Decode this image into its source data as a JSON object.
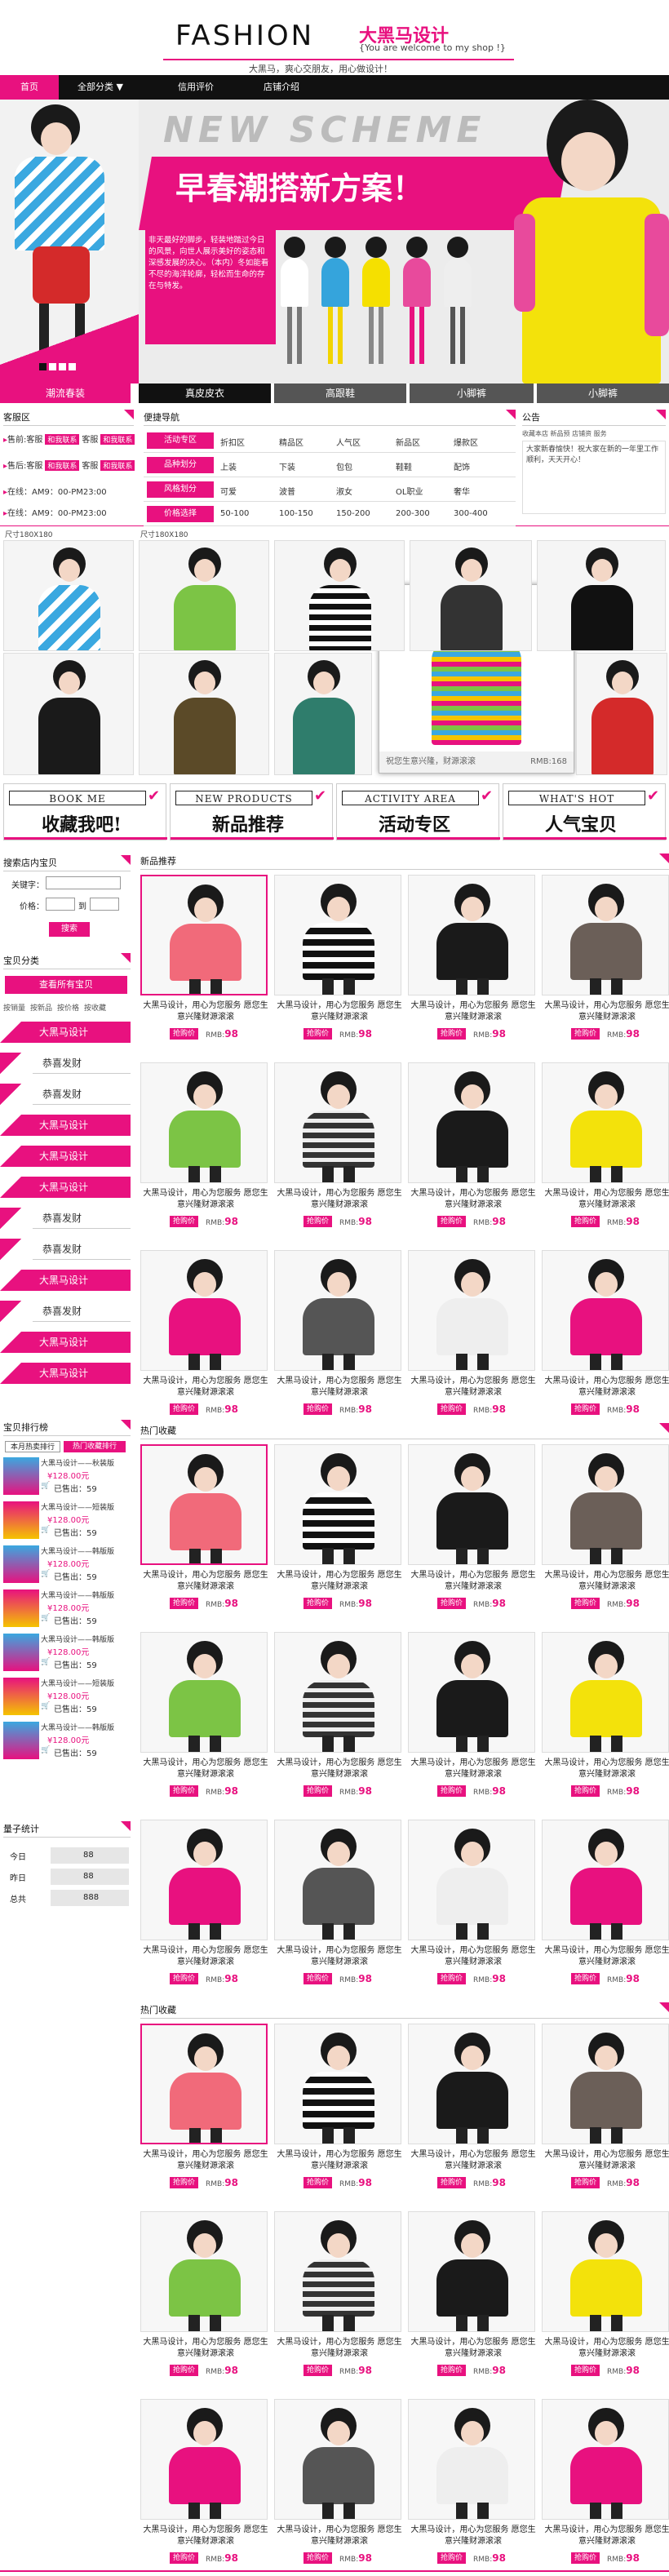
{
  "header": {
    "logo": "FASHION",
    "brand_cn": "大黑马设计",
    "welcome": "{You are welcome to my shop !}",
    "tagline": "大黑马，爽心交朋友，用心做设计！"
  },
  "nav": [
    {
      "label": "首页"
    },
    {
      "label": "全部分类"
    },
    {
      "label": "信用评价"
    },
    {
      "label": "店铺介绍"
    }
  ],
  "banner": {
    "heading_en": "NEW SCHEME",
    "heading_cn": "早春潮搭新方案！",
    "body": "非天最好的脚步，轻装地踏过今日的风景，向世人展示美好的姿态和深感发展的决心。（本内）冬如能看不尽的海洋轮廓，轻松而生命的存在与特发。",
    "tabs": [
      "潮流春装",
      "真皮皮衣",
      "高跟鞋",
      "小脚裤"
    ],
    "dots": 4
  },
  "colors": {
    "accent": "#e8117f",
    "dark": "#111111"
  },
  "service": {
    "title": "客服区",
    "rows": [
      {
        "label": "售前",
        "name": "客服"
      },
      {
        "label": "售后",
        "name": "客服"
      }
    ],
    "hours": [
      {
        "label": "在线",
        "value": "AM9：00-PM23:00"
      },
      {
        "label": "在线",
        "value": "AM9：00-PM23:00"
      }
    ],
    "badge": "和我联系"
  },
  "quicknav": {
    "title": "便捷导航",
    "rows": [
      {
        "tag": "活动专区",
        "items": [
          "折扣区",
          "精品区",
          "人气区",
          "新品区",
          "爆款区"
        ]
      },
      {
        "tag": "品种划分",
        "items": [
          "上装",
          "下装",
          "包包",
          "鞋鞋",
          "配饰"
        ]
      },
      {
        "tag": "风格划分",
        "items": [
          "可爱",
          "波普",
          "淑女",
          "OL职业",
          "奢华"
        ]
      },
      {
        "tag": "价格选择",
        "items": [
          "50-100",
          "100-150",
          "150-200",
          "200-300",
          "300-400"
        ]
      }
    ]
  },
  "notice": {
    "title": "公告",
    "links": "收藏本店 新品预 店铺资 服务",
    "text": "大家新春愉快！祝大家在新的一年里工作顺利，天天开心！"
  },
  "showcase": {
    "size_a": "尺寸180X180",
    "size_b": "尺寸180X180",
    "popup": "祝您生意兴隆，财源滚滚",
    "popup_price": "RMB:168"
  },
  "promo": [
    {
      "en": "BOOK ME",
      "cn": "收藏我吧!"
    },
    {
      "en": "NEW PRODUCTS",
      "cn": "新品推荐"
    },
    {
      "en": "ACTIVITY AREA",
      "cn": "活动专区"
    },
    {
      "en": "WHAT'S HOT",
      "cn": "人气宝贝"
    }
  ],
  "search": {
    "title": "搜索店内宝贝",
    "keyword_label": "关键字：",
    "price_label": "价格：",
    "price_sep": "到",
    "button": "搜索"
  },
  "category": {
    "title": "宝贝分类",
    "all": "查看所有宝贝",
    "tabs": [
      "按销量",
      "按新品",
      "按价格",
      "按收藏"
    ],
    "items": [
      {
        "label": "大黑马设计",
        "big": true
      },
      {
        "label": "恭喜发财",
        "big": false
      },
      {
        "label": "恭喜发财",
        "big": false
      },
      {
        "label": "大黑马设计",
        "big": true
      },
      {
        "label": "大黑马设计",
        "big": true
      },
      {
        "label": "大黑马设计",
        "big": true
      },
      {
        "label": "恭喜发财",
        "big": false
      },
      {
        "label": "恭喜发财",
        "big": false
      },
      {
        "label": "大黑马设计",
        "big": true
      },
      {
        "label": "恭喜发财",
        "big": false
      },
      {
        "label": "大黑马设计",
        "big": true
      },
      {
        "label": "大黑马设计",
        "big": true
      }
    ]
  },
  "ranking": {
    "title": "宝贝排行榜",
    "tabs": [
      "本月热卖排行",
      "热门收藏排行"
    ],
    "items": [
      {
        "name": "大黑马设计——秋装版",
        "price": "¥128.00元",
        "sold": "已售出：59"
      },
      {
        "name": "大黑马设计——短装版",
        "price": "¥128.00元",
        "sold": "已售出：59"
      },
      {
        "name": "大黑马设计——韩版版",
        "price": "¥128.00元",
        "sold": "已售出：59"
      },
      {
        "name": "大黑马设计——韩版版",
        "price": "¥128.00元",
        "sold": "已售出：59"
      },
      {
        "name": "大黑马设计——韩版版",
        "price": "¥128.00元",
        "sold": "已售出：59"
      },
      {
        "name": "大黑马设计——短装版",
        "price": "¥128.00元",
        "sold": "已售出：59"
      },
      {
        "name": "大黑马设计——韩版版",
        "price": "¥128.00元",
        "sold": "已售出：59"
      }
    ]
  },
  "stats": {
    "title": "量子统计",
    "rows": [
      {
        "label": "今日",
        "value": "88"
      },
      {
        "label": "昨日",
        "value": "88"
      },
      {
        "label": "总共",
        "value": "888"
      }
    ]
  },
  "sections": [
    {
      "title": "新品推荐"
    },
    {
      "title": "热门收藏"
    },
    {
      "title": "热门收藏"
    }
  ],
  "product": {
    "desc": "大黑马设计，用心为您服务 愿您生意兴隆财源滚滚",
    "buy": "抢购价",
    "rmb": "RMB:",
    "price": "98"
  }
}
